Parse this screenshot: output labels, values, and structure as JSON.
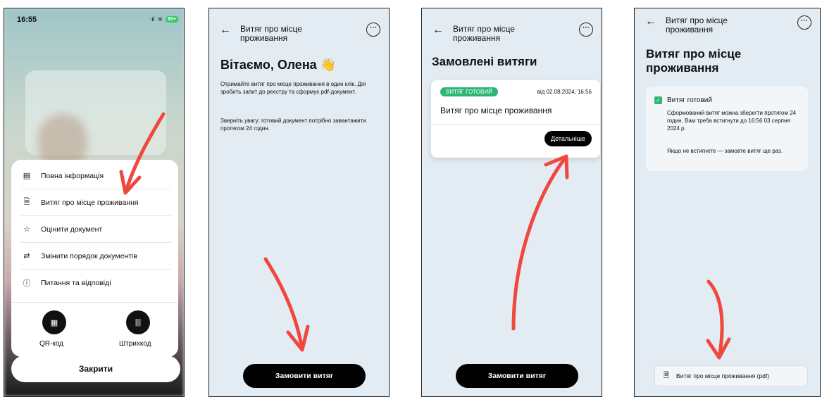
{
  "screen1": {
    "status": {
      "time": "16:55",
      "signal": "‧ıl",
      "wifi": "≋",
      "battery": "80+"
    },
    "menu": [
      {
        "label": "Повна інформація",
        "icon": "document-icon"
      },
      {
        "label": "Витяг про місце проживання",
        "icon": "file-badge-icon"
      },
      {
        "label": "Оцінити документ",
        "icon": "star-icon"
      },
      {
        "label": "Змінити порядок документів",
        "icon": "swap-icon"
      },
      {
        "label": "Питання та відповіді",
        "icon": "question-icon"
      }
    ],
    "qr_label": "QR-код",
    "barcode_label": "Штрихкод",
    "close_label": "Закрити"
  },
  "screen2": {
    "header_title": "Витяг про місце проживання",
    "greeting": "Вітаємо, Олена 👋",
    "paragraph1": "Отримайте витяг про місце проживання в один клік. Дія зробить запит до реєстру та сформує pdf-документ.",
    "paragraph2": "Зверніть увагу: готовий документ потрібно завантажити протягом 24 годин.",
    "order_button": "Замовити витяг"
  },
  "screen3": {
    "header_title": "Витяг про місце проживання",
    "section_title": "Замовлені витяги",
    "card": {
      "status": "Витяг готовий",
      "date": "від 02.08.2024, 16:56",
      "title": "Витяг про місце проживання",
      "details_button": "Детальніше"
    },
    "order_button": "Замовити витяг"
  },
  "screen4": {
    "header_title": "Витяг про місце проживання",
    "title": "Витяг про місце проживання",
    "info_title": "Витяг готовий",
    "info_text1": "Сформований витяг можна зберегти протягом 24 годин. Вам треба встигнути до 16:56 03 серпня 2024 р.",
    "info_text2": "Якщо не встигнете — замовте витяг ще раз.",
    "pdf_button": "Витяг про місце проживання (pdf)"
  },
  "colors": {
    "accent_green": "#2bb673",
    "arrow_red": "#f0473e",
    "screen_bg": "#e3ecf3"
  }
}
